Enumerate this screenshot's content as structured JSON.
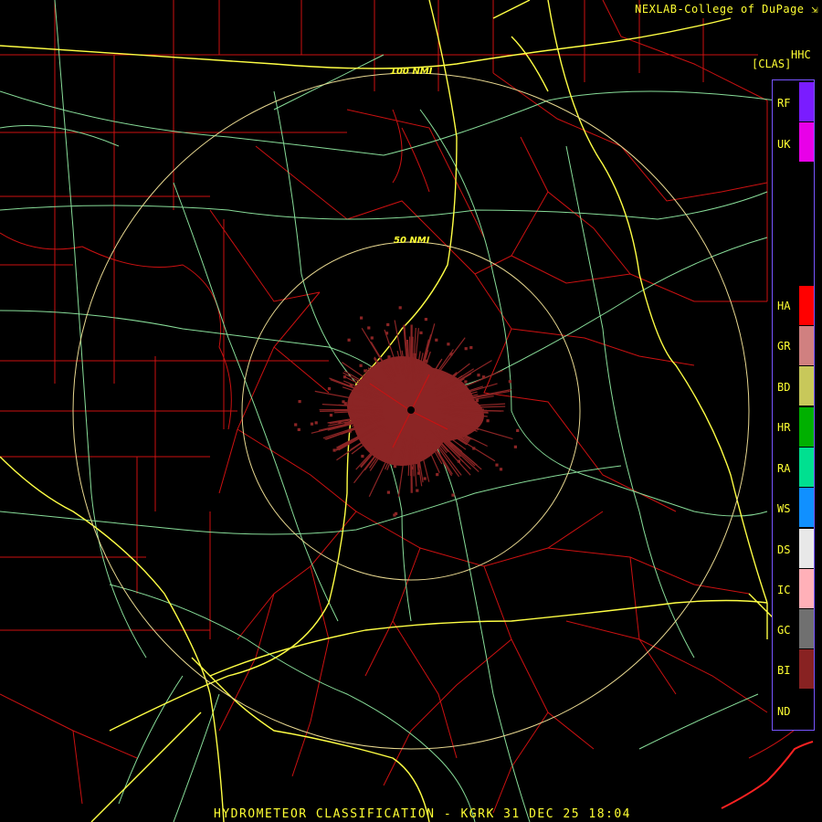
{
  "header": {
    "credit": "NEXLAB-College of DuPage",
    "product_code": "HHC",
    "product_class": "[CLAS]"
  },
  "footer": {
    "title": "HYDROMETEOR CLASSIFICATION - KGRK 31 DEC 25 18:04"
  },
  "range_rings": {
    "inner_label": "50 NMI",
    "outer_label": "100 NMI"
  },
  "legend": [
    {
      "code": "RF",
      "color": "#7a1cff"
    },
    {
      "code": "UK",
      "color": "#e800e8"
    },
    {
      "code": "HA",
      "color": "#ff0000"
    },
    {
      "code": "GR",
      "color": "#d08080"
    },
    {
      "code": "BD",
      "color": "#c8c85a"
    },
    {
      "code": "HR",
      "color": "#00b000"
    },
    {
      "code": "RA",
      "color": "#00e090"
    },
    {
      "code": "WS",
      "color": "#1090ff"
    },
    {
      "code": "DS",
      "color": "#e8e8e8"
    },
    {
      "code": "IC",
      "color": "#ffb0b8"
    },
    {
      "code": "GC",
      "color": "#707070"
    },
    {
      "code": "BI",
      "color": "#882222"
    },
    {
      "code": "ND",
      "color": "#000000"
    }
  ],
  "map_colors": {
    "county_lines": "#cc1111",
    "highways": "#ffff44",
    "roads": "#88dd99",
    "rings": "#e8d890",
    "echo": "#8b2525"
  }
}
